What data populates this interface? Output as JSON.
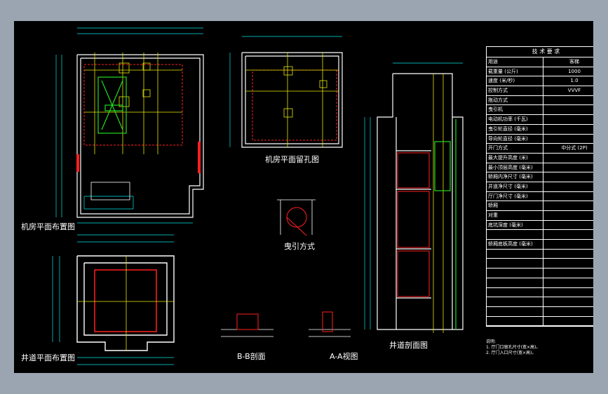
{
  "views": {
    "machine_room_plan": "机房平面布置图",
    "machine_room_holes": "机房平面留孔图",
    "traction": "曳引方式",
    "hoistway_plan": "井道平面布置图",
    "section_b": "B-B剖面",
    "view_a": "A-A视图",
    "hoistway_section": "井道剖面图"
  },
  "spec_table": {
    "title": "技 术 要 求",
    "rows": [
      {
        "k": "用途",
        "v": "客梯"
      },
      {
        "k": "载重量 (公斤)",
        "v": "1000"
      },
      {
        "k": "速度 (米/秒)",
        "v": "1.0"
      },
      {
        "k": "控制方式",
        "v": "VVVF"
      },
      {
        "k": "拖动方式",
        "v": ""
      },
      {
        "k": "曳引机",
        "v": ""
      },
      {
        "k": "电动机功率 (千瓦)",
        "v": ""
      },
      {
        "k": "曳引轮直径 (毫米)",
        "v": ""
      },
      {
        "k": "导向轮直径 (毫米)",
        "v": ""
      },
      {
        "k": "开门方式",
        "v": "中分式 (2P)"
      },
      {
        "k": "最大提升高度 (米)",
        "v": ""
      },
      {
        "k": "最小顶层高度 (毫米)",
        "v": ""
      },
      {
        "k": "轿厢内净尺寸 (毫米)",
        "v": ""
      },
      {
        "k": "井道净尺寸 (毫米)",
        "v": ""
      },
      {
        "k": "厅门净尺寸 (毫米)",
        "v": ""
      },
      {
        "k": "轿厢",
        "v": ""
      },
      {
        "k": "对重",
        "v": ""
      },
      {
        "k": "底坑深度 (毫米)",
        "v": ""
      },
      {
        "k": "",
        "v": ""
      },
      {
        "k": "轿厢底板高度 (毫米)",
        "v": ""
      },
      {
        "k": "",
        "v": ""
      },
      {
        "k": "",
        "v": ""
      },
      {
        "k": "",
        "v": ""
      },
      {
        "k": "",
        "v": ""
      },
      {
        "k": "",
        "v": ""
      },
      {
        "k": "",
        "v": ""
      },
      {
        "k": "",
        "v": ""
      },
      {
        "k": "",
        "v": ""
      }
    ]
  },
  "notes": {
    "label": "说明:",
    "n1": "1. 厅门口留孔尺寸(宽×高)。",
    "n2": "2. 厅门入口尺寸(宽×高)。"
  }
}
